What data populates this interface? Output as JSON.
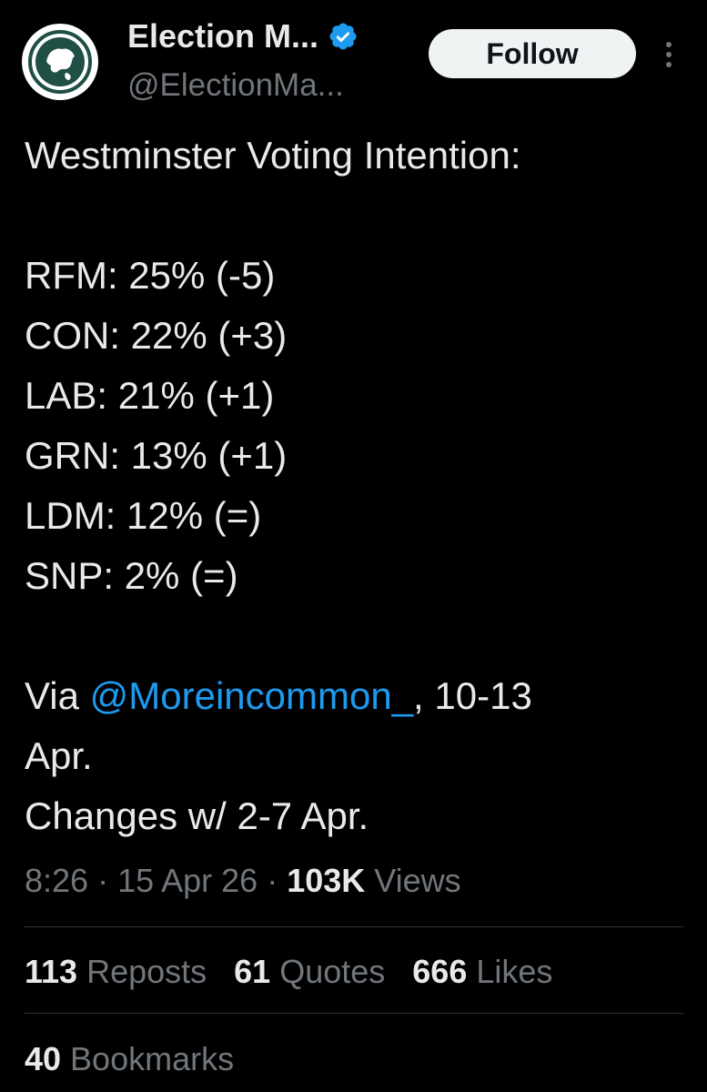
{
  "author": {
    "display_name": "Election M...",
    "handle": "@ElectionMa...",
    "verified_icon": "verified-badge-icon",
    "avatar_icon": "globe-map-logo",
    "accent_color": "#1d9bf0",
    "avatar_color": "#1f4f45"
  },
  "header": {
    "follow_label": "Follow",
    "more_icon": "more-options-icon"
  },
  "tweet": {
    "heading": "Westminster Voting Intention:",
    "polls": [
      "RFM: 25% (-5)",
      "CON: 22% (+3)",
      "LAB: 21% (+1)",
      "GRN: 13% (+1)",
      "LDM: 12% (=)",
      "SNP: 2% (=)"
    ],
    "via_prefix": "Via ",
    "via_mention": "@Moreincommon_",
    "via_suffix": ", 10-13",
    "via_line2": "Apr.",
    "changes_line": "Changes w/ 2-7 Apr."
  },
  "meta": {
    "time": "8:26",
    "sep1": " · ",
    "date": "15 Apr 26",
    "sep2": " · ",
    "views_count": "103K",
    "views_label": " Views"
  },
  "stats": {
    "reposts_count": "113",
    "reposts_label": " Reposts",
    "quotes_count": "61",
    "quotes_label": " Quotes",
    "likes_count": "666",
    "likes_label": " Likes",
    "bookmarks_count": "40",
    "bookmarks_label": " Bookmarks"
  }
}
